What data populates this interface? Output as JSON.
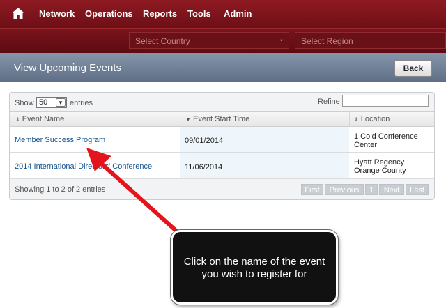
{
  "topnav": {
    "home_icon": "home-icon",
    "items": [
      {
        "label": "Network"
      },
      {
        "label": "Operations"
      },
      {
        "label": "Reports"
      },
      {
        "label": "Tools"
      },
      {
        "label": "Admin"
      }
    ]
  },
  "filters": {
    "country_placeholder": "Select Country",
    "region_placeholder": "Select Region"
  },
  "header": {
    "title": "View Upcoming Events",
    "back_label": "Back"
  },
  "table": {
    "show_label": "Show",
    "entries_value": "50",
    "entries_label": "entries",
    "refine_label": "Refine",
    "refine_value": "",
    "columns": [
      {
        "label": "Event Name",
        "sort": "sortable"
      },
      {
        "label": "Event Start Time",
        "sort": "descending"
      },
      {
        "label": "Location",
        "sort": "sortable"
      }
    ],
    "rows": [
      {
        "name": "Member Success Program",
        "start": "09/01/2014",
        "location_line1": "1 Cold Conference",
        "location_line2": "Center"
      },
      {
        "name": "2014 International Directors' Conference",
        "start": "11/06/2014",
        "location_line1": "Hyatt Regency",
        "location_line2": "Orange County"
      }
    ],
    "info": "Showing 1 to 2 of 2 entries",
    "pagination": {
      "first": "First",
      "previous": "Previous",
      "current": "1",
      "next": "Next",
      "last": "Last"
    }
  },
  "callout": {
    "text": "Click on the name of the event you wish to register for",
    "arrow_color": "#e3141b"
  },
  "colors": {
    "nav_bg": "#7a141b",
    "header_bg": "#6f7f95",
    "link": "#14558f"
  }
}
